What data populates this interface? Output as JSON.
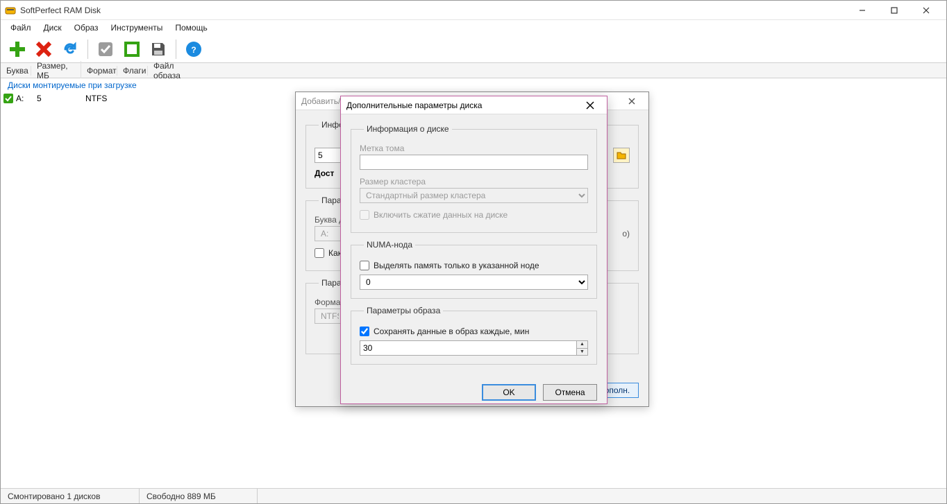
{
  "app": {
    "title": "SoftPerfect RAM Disk"
  },
  "menu": {
    "file": "Файл",
    "disk": "Диск",
    "image": "Образ",
    "tools": "Инструменты",
    "help": "Помощь"
  },
  "cols": {
    "letter": "Буква",
    "sizemb": "Размер, МБ",
    "format": "Формат",
    "flags": "Флаги",
    "imagefile": "Файл образа"
  },
  "group": {
    "boot_mount": "Диски монтируемые при загрузке"
  },
  "rows": [
    {
      "letter": "A:",
      "size": "5",
      "format": "NTFS"
    }
  ],
  "status": {
    "mounted": "Смонтировано 1 дисков",
    "free": "Свободно 889 МБ"
  },
  "dlg1": {
    "title": "Добавить/И",
    "info": "Информация",
    "size_value": "5",
    "avail": "Дост",
    "params": "Параметр",
    "drive_letter_label": "Буква д",
    "drive_letter_value": "A:",
    "as_label": "Как",
    "o_paren": "о)",
    "params2": "Параметр",
    "format_label": "Формат",
    "format_value": "NTFS",
    "extra_btn": "ополн."
  },
  "dlg2": {
    "title": "Дополнительные параметры диска",
    "grp_info": "Информация о диске",
    "volume_label": "Метка тома",
    "volume_value": "",
    "cluster_label": "Размер кластера",
    "cluster_value": "Стандартный размер кластера",
    "compress": "Включить сжатие данных на диске",
    "grp_numa": "NUMA-нода",
    "numa_check": "Выделять память только в указанной ноде",
    "numa_value": "0",
    "grp_image": "Параметры образа",
    "save_every": "Сохранять данные в образ каждые, мин",
    "save_value": "30",
    "ok": "OK",
    "cancel": "Отмена"
  }
}
